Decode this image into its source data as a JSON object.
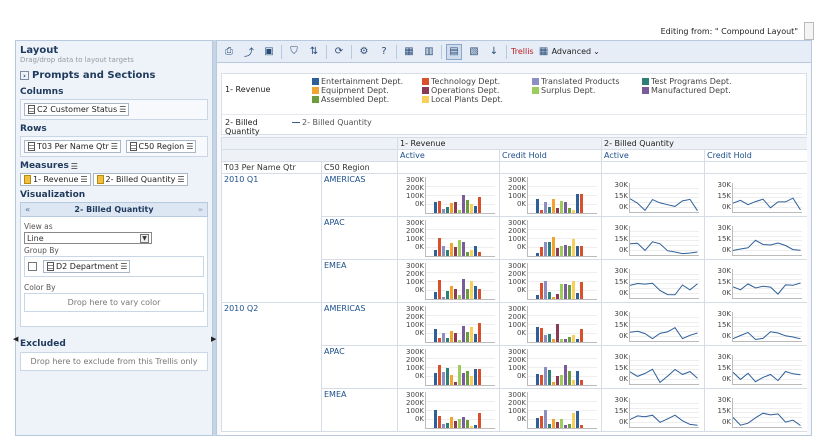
{
  "header": {
    "editing_text": "Editing from: \" Compound Layout\""
  },
  "layout_panel": {
    "title": "Layout",
    "hint": "Drag/drop data to layout targets",
    "prompts_label": "Prompts and Sections",
    "columns_label": "Columns",
    "columns_item": "C2 Customer Status",
    "rows_label": "Rows",
    "rows_items": [
      "T03 Per Name Qtr",
      "C50 Region"
    ],
    "measures_label": "Measures",
    "measures_items": [
      "1- Revenue",
      "2- Billed Quantity"
    ],
    "visualization_label": "Visualization",
    "vis_title": "2- Billed Quantity",
    "view_as_label": "View as",
    "view_as_value": "Line",
    "group_by_label": "Group By",
    "group_by_item": "D2 Department",
    "color_by_label": "Color By",
    "color_by_hint": "Drop here to vary color",
    "excluded_label": "Excluded",
    "excluded_hint": "Drop here to exclude from this Trellis only"
  },
  "toolbar": {
    "trellis_label": "Trellis",
    "advanced_label": "Advanced"
  },
  "legend": {
    "revenue_label": "1- Revenue",
    "billed_label": "2- Billed Quantity",
    "billed_item": "2- Billed Quantity",
    "items": [
      {
        "name": "Entertainment Dept.",
        "color": "#2e5f99"
      },
      {
        "name": "Technology Dept.",
        "color": "#d9512c"
      },
      {
        "name": "Translated Products",
        "color": "#8b8fc4"
      },
      {
        "name": "Test Programs Dept.",
        "color": "#2e7f78"
      },
      {
        "name": "Equipment Dept.",
        "color": "#f3a330"
      },
      {
        "name": "Operations Dept.",
        "color": "#8a3a52"
      },
      {
        "name": "Surplus Dept.",
        "color": "#9ccc5c"
      },
      {
        "name": "Manufactured Dept.",
        "color": "#7a5c9c"
      },
      {
        "name": "Assembled Dept.",
        "color": "#6c9c3c"
      },
      {
        "name": "Local Plants Dept.",
        "color": "#f6d05a"
      }
    ]
  },
  "grid": {
    "col_group_revenue": "1- Revenue",
    "col_group_billed": "2- Billed Quantity",
    "col_active": "Active",
    "col_credit_hold": "Credit Hold",
    "row_hdr_qtr": "T03 Per Name Qtr",
    "row_hdr_region": "C50 Region",
    "bar_ticks": [
      "300K",
      "200K",
      "100K",
      "0K"
    ],
    "line_ticks": [
      "30K",
      "15K",
      "0K"
    ],
    "qtrs": [
      {
        "label": "2010 Q1",
        "regions": [
          "AMERICAS",
          "APAC",
          "EMEA"
        ]
      },
      {
        "label": "2010 Q2",
        "regions": [
          "AMERICAS",
          "APAC",
          "EMEA"
        ]
      }
    ]
  }
}
